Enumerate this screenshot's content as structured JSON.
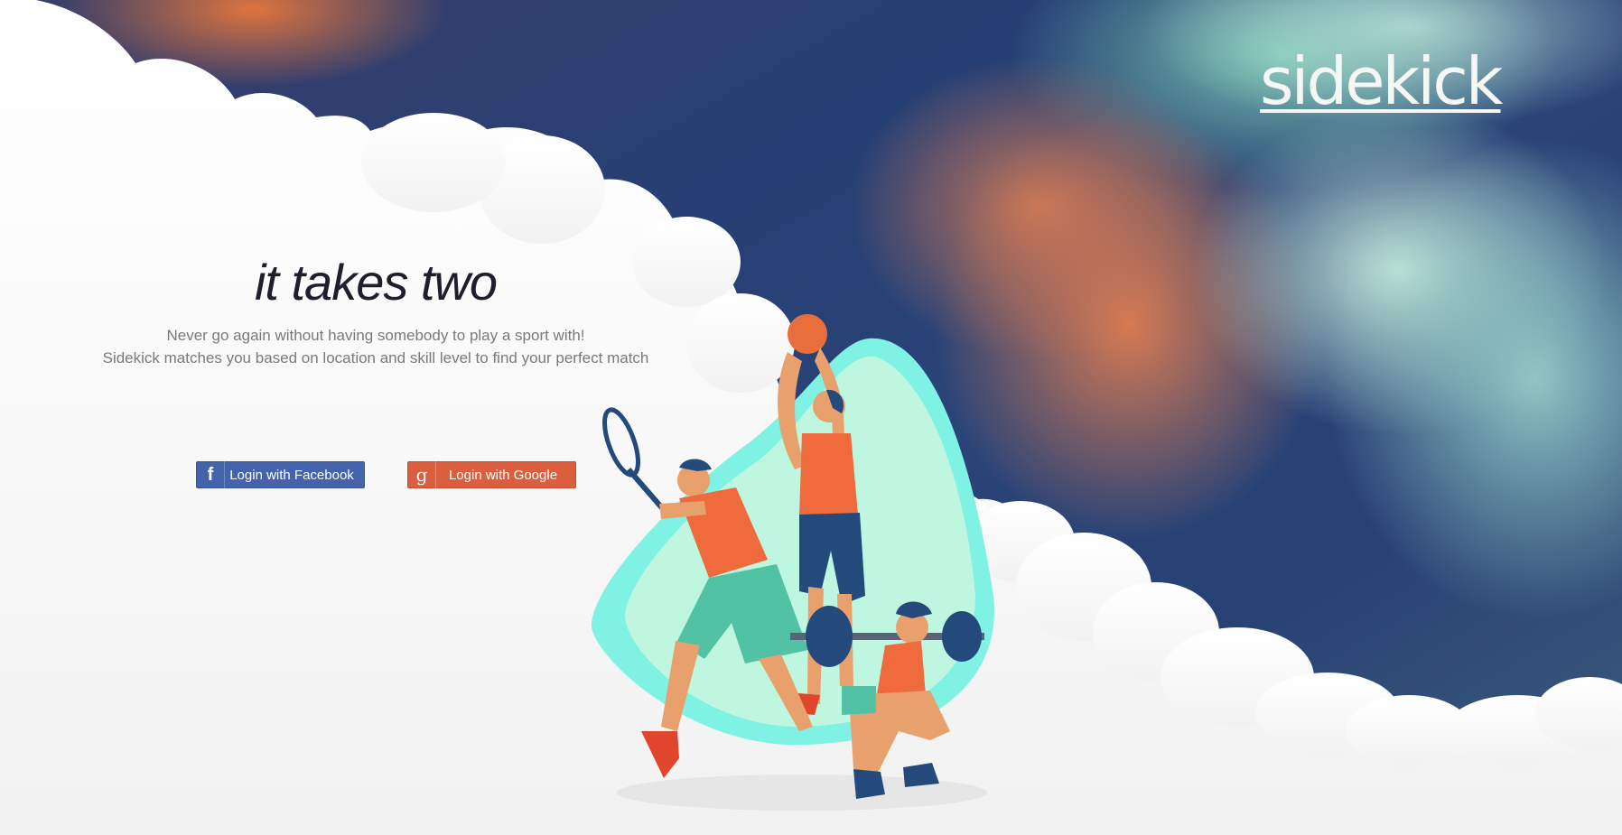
{
  "brand": {
    "logo": "sidekick"
  },
  "hero": {
    "title": "it takes two",
    "subtitle_line1": "Never go again without having somebody to play a sport with!",
    "subtitle_line2": "Sidekick matches you based on location and skill level to find your perfect match"
  },
  "auth": {
    "facebook": {
      "label": "Login with Facebook",
      "icon": "facebook-icon",
      "color": "#4563ab"
    },
    "google": {
      "label": "Login with Google",
      "icon": "google-icon",
      "color": "#db5f3e"
    }
  },
  "illustration": {
    "subject": "athletes-illustration"
  }
}
